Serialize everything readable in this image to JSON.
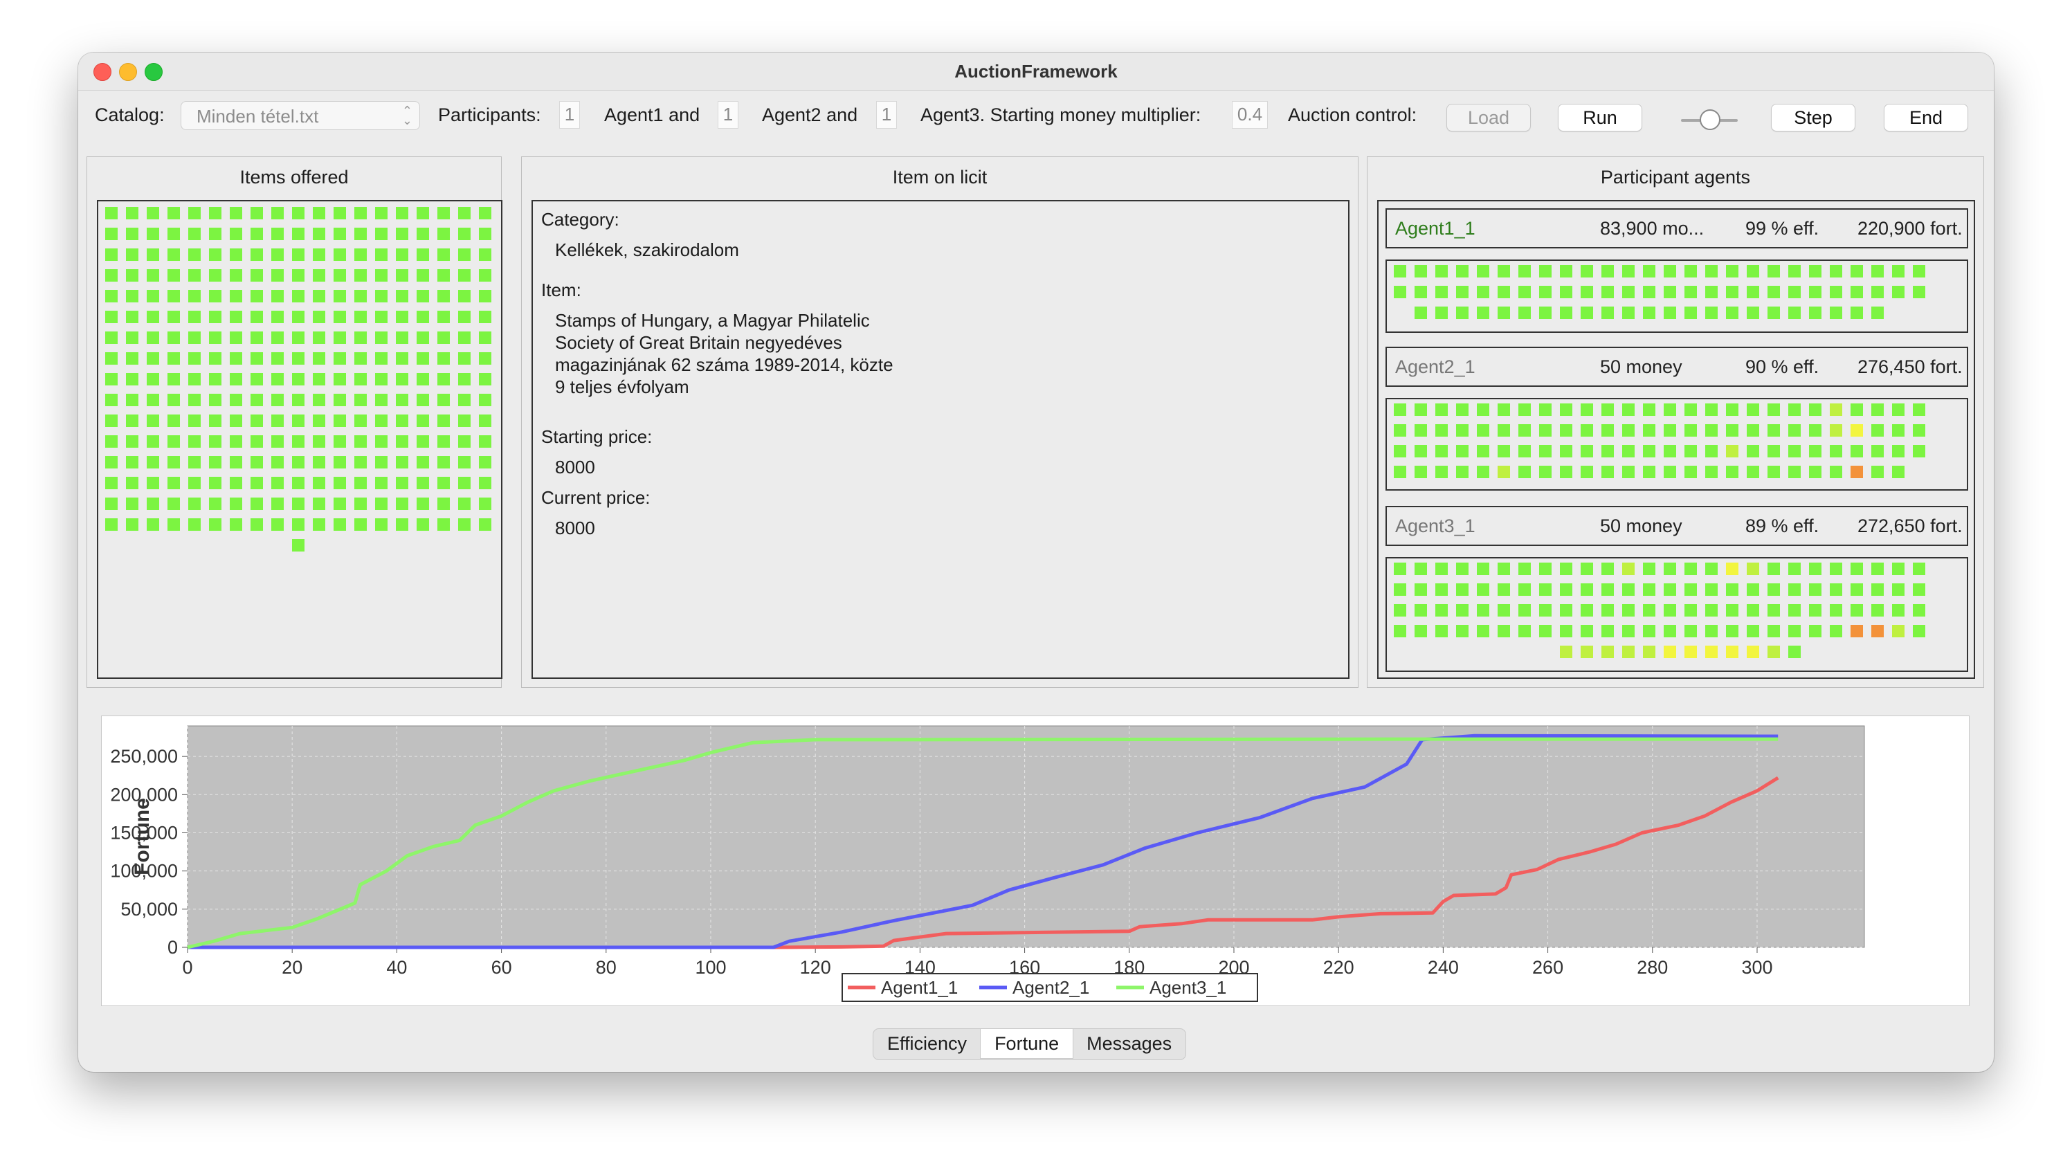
{
  "window": {
    "title": "AuctionFramework"
  },
  "toolbar": {
    "catalog_label": "Catalog:",
    "catalog_value": "Minden tétel.txt",
    "participants_label": "Participants:",
    "agent1_count": "1",
    "agent1_label": "Agent1 and",
    "agent2_count": "1",
    "agent2_label": "Agent2 and",
    "agent3_count": "1",
    "agent3_label": "Agent3. Starting money multiplier:",
    "multiplier": "0.4",
    "control_label": "Auction control:",
    "load": "Load",
    "run": "Run",
    "step": "Step",
    "end": "End"
  },
  "items_offered": {
    "title": "Items offered",
    "rows": 16,
    "cols": 19,
    "extra": 1,
    "color": "#7cf441"
  },
  "item_on_licit": {
    "title": "Item on licit",
    "category_label": "Category:",
    "category": "Kellékek, szakirodalom",
    "item_label": "Item:",
    "item_lines": [
      "Stamps of Hungary, a Magyar Philatelic",
      "Society of Great Britain negyedéves",
      "magazinjának 62 száma 1989-2014, közte",
      "9 teljes évfolyam"
    ],
    "starting_price_label": "Starting price:",
    "starting_price": "8000",
    "current_price_label": "Current price:",
    "current_price": "8000"
  },
  "participant_agents": {
    "title": "Participant agents",
    "agents": [
      {
        "name": "Agent1_1",
        "money": "83,900 mo...",
        "eff": "99 % eff.",
        "fortune": "220,900 fort.",
        "name_color": "#2e7d1b"
      },
      {
        "name": "Agent2_1",
        "money": "50 money",
        "eff": "90 % eff.",
        "fortune": "276,450 fort.",
        "name_color": "#777777"
      },
      {
        "name": "Agent3_1",
        "money": "50 money",
        "eff": "89 % eff.",
        "fortune": "272,650 fort.",
        "name_color": "#777777"
      }
    ]
  },
  "colors": {
    "green": "#7cf441",
    "lightgreen": "#bff040",
    "yellow": "#f2f53f",
    "orange": "#f3923a",
    "agent1": "#f25e5e",
    "agent2": "#5a5af5",
    "agent3": "#8ef56a"
  },
  "chart_data": {
    "type": "line",
    "ylabel": "Fortune",
    "xlabel": "",
    "xlim": [
      0,
      320
    ],
    "ylim": [
      0,
      290000
    ],
    "x_ticks": [
      "0",
      "20",
      "40",
      "60",
      "80",
      "100",
      "120",
      "140",
      "160",
      "180",
      "200",
      "220",
      "240",
      "260",
      "280",
      "300"
    ],
    "y_ticks": [
      "0",
      "50,000",
      "100,000",
      "150,000",
      "200,000",
      "250,000"
    ],
    "grid": true,
    "legend_position": "bottom",
    "series": [
      {
        "name": "Agent1_1",
        "color": "#f25e5e",
        "points": [
          [
            0,
            0
          ],
          [
            112,
            0
          ],
          [
            125,
            500
          ],
          [
            133,
            1500
          ],
          [
            135,
            9000
          ],
          [
            145,
            18000
          ],
          [
            180,
            21000
          ],
          [
            182,
            27000
          ],
          [
            190,
            31000
          ],
          [
            195,
            36000
          ],
          [
            215,
            36000
          ],
          [
            220,
            40000
          ],
          [
            228,
            44000
          ],
          [
            238,
            45000
          ],
          [
            240,
            60000
          ],
          [
            242,
            68000
          ],
          [
            250,
            70000
          ],
          [
            252,
            78000
          ],
          [
            253,
            95000
          ],
          [
            258,
            102000
          ],
          [
            262,
            115000
          ],
          [
            268,
            125000
          ],
          [
            273,
            135000
          ],
          [
            278,
            150000
          ],
          [
            285,
            160000
          ],
          [
            290,
            172000
          ],
          [
            295,
            190000
          ],
          [
            300,
            205000
          ],
          [
            304,
            222000
          ]
        ]
      },
      {
        "name": "Agent2_1",
        "color": "#5a5af5",
        "points": [
          [
            0,
            0
          ],
          [
            112,
            0
          ],
          [
            115,
            8000
          ],
          [
            125,
            20000
          ],
          [
            135,
            35000
          ],
          [
            150,
            55000
          ],
          [
            157,
            75000
          ],
          [
            165,
            90000
          ],
          [
            175,
            108000
          ],
          [
            183,
            130000
          ],
          [
            193,
            150000
          ],
          [
            205,
            170000
          ],
          [
            215,
            195000
          ],
          [
            225,
            210000
          ],
          [
            233,
            240000
          ],
          [
            236,
            272000
          ],
          [
            246,
            277000
          ],
          [
            304,
            276450
          ]
        ]
      },
      {
        "name": "Agent3_1",
        "color": "#8ef56a",
        "points": [
          [
            0,
            0
          ],
          [
            5,
            8000
          ],
          [
            10,
            18000
          ],
          [
            15,
            22000
          ],
          [
            20,
            26000
          ],
          [
            25,
            38000
          ],
          [
            32,
            58000
          ],
          [
            33,
            82000
          ],
          [
            38,
            100000
          ],
          [
            42,
            120000
          ],
          [
            47,
            132000
          ],
          [
            52,
            140000
          ],
          [
            55,
            160000
          ],
          [
            60,
            172000
          ],
          [
            65,
            190000
          ],
          [
            70,
            205000
          ],
          [
            77,
            218000
          ],
          [
            85,
            230000
          ],
          [
            95,
            245000
          ],
          [
            100,
            255000
          ],
          [
            108,
            268000
          ],
          [
            120,
            272000
          ],
          [
            236,
            272650
          ],
          [
            304,
            272650
          ]
        ]
      }
    ]
  },
  "tabs": [
    "Efficiency",
    "Fortune",
    "Messages"
  ]
}
